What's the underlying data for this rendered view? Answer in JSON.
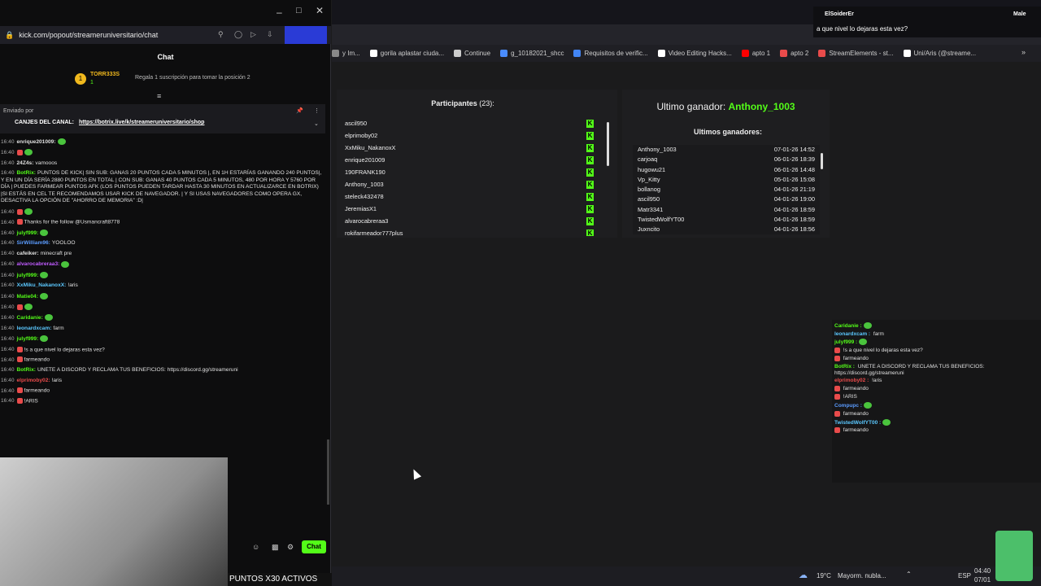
{
  "popout": {
    "url": "kick.com/popout/streameruniversitario/chat",
    "chat_title": "Chat",
    "top_gifter": {
      "name": "TORR333S",
      "count": "1",
      "action": "Regala 1 suscripción para tomar la posición 2"
    },
    "pinned": {
      "sent_by": "Enviado por",
      "label": "CANJES DEL CANAL:",
      "link": "https://botrix.live/k/streameruniversitario/shop"
    },
    "messages": [
      {
        "time": "16:40",
        "user": "enrique201009:",
        "color": "#e0e0e0",
        "text": ""
      },
      {
        "time": "16:40",
        "user": "",
        "color": "#e94b4b",
        "text": ""
      },
      {
        "time": "16:40",
        "user": "24Z4s:",
        "color": "#e0e0e0",
        "text": "vamooos"
      },
      {
        "time": "16:40",
        "user": "BotRix:",
        "color": "#53fc18",
        "text": "PUNTOS DE KICK| SIN SUB: GANAS 20 PUNTOS CADA 5 MINUTOS |, EN 1H ESTARÍAS GANANDO 240 PUNTOS|, Y EN UN DÍA SERÍA 2880 PUNTOS EN TOTAL | CON SUB: GANAS 40 PUNTOS CADA 5 MINUTOS, 480 POR HORA Y 5760 POR DÍA | PUEDES FARMEAR PUNTOS AFK (LOS PUNTOS PUEDEN TARDAR HASTA 30 MINUTOS EN ACTUALIZARCE EN BOTRIX) |SI ESTÁS EN CEL TE RECOMENDAMOS USAR KICK DE NAVEGADOR. | Y SI USAS NAVEGADORES COMO OPERA GX, DESACTIVA LA OPCIÓN DE \"AHORRO DE MEMORIA\" :D|"
      },
      {
        "time": "16:40",
        "user": "",
        "color": "#e94b4b",
        "text": ""
      },
      {
        "time": "16:40",
        "user": "",
        "color": "#e94b4b",
        "text": "Thanks for the follow @Usmancraft8778"
      },
      {
        "time": "16:40",
        "user": "julyf999:",
        "color": "#53fc18",
        "text": ""
      },
      {
        "time": "16:40",
        "user": "SirWilliam96:",
        "color": "#5b9cff",
        "text": "YOOLOO"
      },
      {
        "time": "16:40",
        "user": "cafeiker:",
        "color": "#e0e0e0",
        "text": "minecraft pre"
      },
      {
        "time": "16:40",
        "user": "alvarocabreraa3:",
        "color": "#c05bff",
        "text": ""
      },
      {
        "time": "16:40",
        "user": "julyf999:",
        "color": "#53fc18",
        "text": ""
      },
      {
        "time": "16:40",
        "user": "XxMiku_NakanoxX:",
        "color": "#5bc8ff",
        "text": "!aris"
      },
      {
        "time": "16:40",
        "user": "Matie04:",
        "color": "#53fc18",
        "text": ""
      },
      {
        "time": "16:40",
        "user": "",
        "color": "#e94b4b",
        "text": ""
      },
      {
        "time": "16:40",
        "user": "Caridanie:",
        "color": "#53fc18",
        "text": ""
      },
      {
        "time": "16:40",
        "user": "leonardxcam:",
        "color": "#5bc8ff",
        "text": "farm"
      },
      {
        "time": "16:40",
        "user": "julyf999:",
        "color": "#53fc18",
        "text": ""
      },
      {
        "time": "16:40",
        "user": "",
        "color": "#e94b4b",
        "text": "!s a que nivel lo dejaras esta vez?"
      },
      {
        "time": "16:40",
        "user": "",
        "color": "#e94b4b",
        "text": "farmeando"
      },
      {
        "time": "16:40",
        "user": "BotRix:",
        "color": "#53fc18",
        "text": "UNETE A DISCORD Y RECLAMA TUS BENEFICIOS: https://discord.gg/streameruni"
      },
      {
        "time": "16:40",
        "user": "elprimoby02:",
        "color": "#e94b4b",
        "text": "!aris"
      },
      {
        "time": "16:40",
        "user": "",
        "color": "#e94b4b",
        "text": "farmeando"
      },
      {
        "time": "16:40",
        "user": "",
        "color": "#e94b4b",
        "text": "!ARIS"
      }
    ],
    "chat_button": "Chat",
    "puntos_banner": "PUNTOS X30 ACTIVOS"
  },
  "bookmarks": [
    "y Im...",
    "gorila aplastar ciuda...",
    "Continue",
    "g_10182021_shcc",
    "Requisitos de verific...",
    "Video Editing Hacks...",
    "apto 1",
    "apto 2",
    "StreamElements - st...",
    "Uni/Aris (@streame..."
  ],
  "participants": {
    "title": "Participantes",
    "count": "(23):",
    "names": [
      "ascil950",
      "elprimoby02",
      "XxMiku_NakanoxX",
      "enrique201009",
      "190FRANK190",
      "Anthony_1003",
      "steleck432478",
      "JeremiasX1",
      "alvarocabreraa3",
      "rokifarmeador777plus"
    ]
  },
  "winners": {
    "last_label": "Ultimo ganador:",
    "last_name": "Anthony_1003",
    "list_title": "Ultimos ganadores:",
    "rows": [
      {
        "name": "Anthony_1003",
        "date": "07-01-26 14:52"
      },
      {
        "name": "carjoaq",
        "date": "06-01-26 18:39"
      },
      {
        "name": "hugowu21",
        "date": "06-01-26 14:48"
      },
      {
        "name": "Vp_Kitty",
        "date": "05-01-26 15:08"
      },
      {
        "name": "bollanog",
        "date": "04-01-26 21:19"
      },
      {
        "name": "ascil950",
        "date": "04-01-26 19:00"
      },
      {
        "name": "Matr3341",
        "date": "04-01-26 18:59"
      },
      {
        "name": "TwistedWolfYT00",
        "date": "04-01-26 18:59"
      },
      {
        "name": "Juxncito",
        "date": "04-01-26 18:56"
      }
    ]
  },
  "notification": {
    "user": "ElSoiderEr",
    "right_user": "Male",
    "text": "a que nivel lo dejaras esta vez?"
  },
  "overlay": {
    "messages": [
      {
        "user": "Caridanie :",
        "color": "#53fc18",
        "text": ""
      },
      {
        "user": "leonardxcam :",
        "color": "#5bc8ff",
        "text": "farm"
      },
      {
        "user": "julyf999 :",
        "color": "#53fc18",
        "text": ""
      },
      {
        "user": "",
        "color": "#e94b4b",
        "text": "!s a que nivel lo dejaras esta vez?"
      },
      {
        "user": "",
        "color": "#e94b4b",
        "text": "farmeando"
      },
      {
        "user": "BotRix :",
        "color": "#53fc18",
        "text": "UNETE A DISCORD Y RECLAMA TUS BENEFICIOS: https://discord.gg/streameruni"
      },
      {
        "user": "elprimoby02 :",
        "color": "#e94b4b",
        "text": "!aris"
      },
      {
        "user": "",
        "color": "#e94b4b",
        "text": "farmeando"
      },
      {
        "user": "",
        "color": "#e94b4b",
        "text": "!ARIS"
      },
      {
        "user": "Compupc :",
        "color": "#5b9cff",
        "text": ""
      },
      {
        "user": "",
        "color": "#e94b4b",
        "text": "farmeando"
      },
      {
        "user": "TwistedWolfYT00 :",
        "color": "#5bc8ff",
        "text": ""
      },
      {
        "user": "",
        "color": "#e94b4b",
        "text": "farmeando"
      }
    ]
  },
  "taskbar": {
    "weather": "19°C",
    "weather_desc": "Mayorm. nubla...",
    "lang": "ESP",
    "time": "04:40",
    "date": "07/01"
  }
}
